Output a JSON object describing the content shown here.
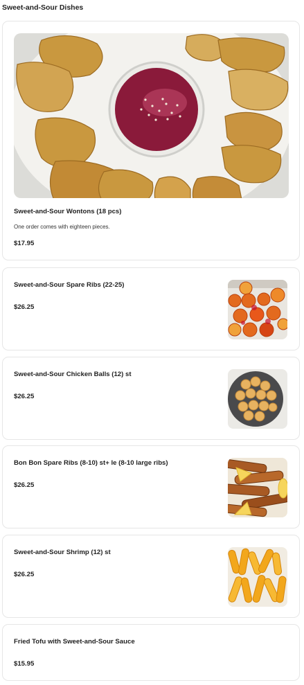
{
  "section": {
    "title": "Sweet-and-Sour Dishes"
  },
  "items": [
    {
      "name": "Sweet-and-Sour Wontons (18 pcs)",
      "description": "One order comes with eighteen pieces.",
      "price": "$17.95",
      "image_icon": "wontons-photo"
    },
    {
      "name": "Sweet-and-Sour Spare Ribs (22-25)",
      "price": "$26.25",
      "image_icon": "spare-ribs-photo"
    },
    {
      "name": "Sweet-and-Sour Chicken Balls (12) st",
      "price": "$26.25",
      "image_icon": "chicken-balls-photo"
    },
    {
      "name": "Bon Bon Spare Ribs (8-10) st+ le (8-10 large ribs)",
      "price": "$26.25",
      "image_icon": "bon-bon-ribs-photo"
    },
    {
      "name": "Sweet-and-Sour Shrimp (12) st",
      "price": "$26.25",
      "image_icon": "shrimp-photo"
    },
    {
      "name": "Fried Tofu with Sweet-and-Sour Sauce",
      "price": "$15.95"
    }
  ],
  "colors": {
    "card_border": "#e6e6e6",
    "text": "#222222",
    "sauce": "#8a1a3a"
  }
}
